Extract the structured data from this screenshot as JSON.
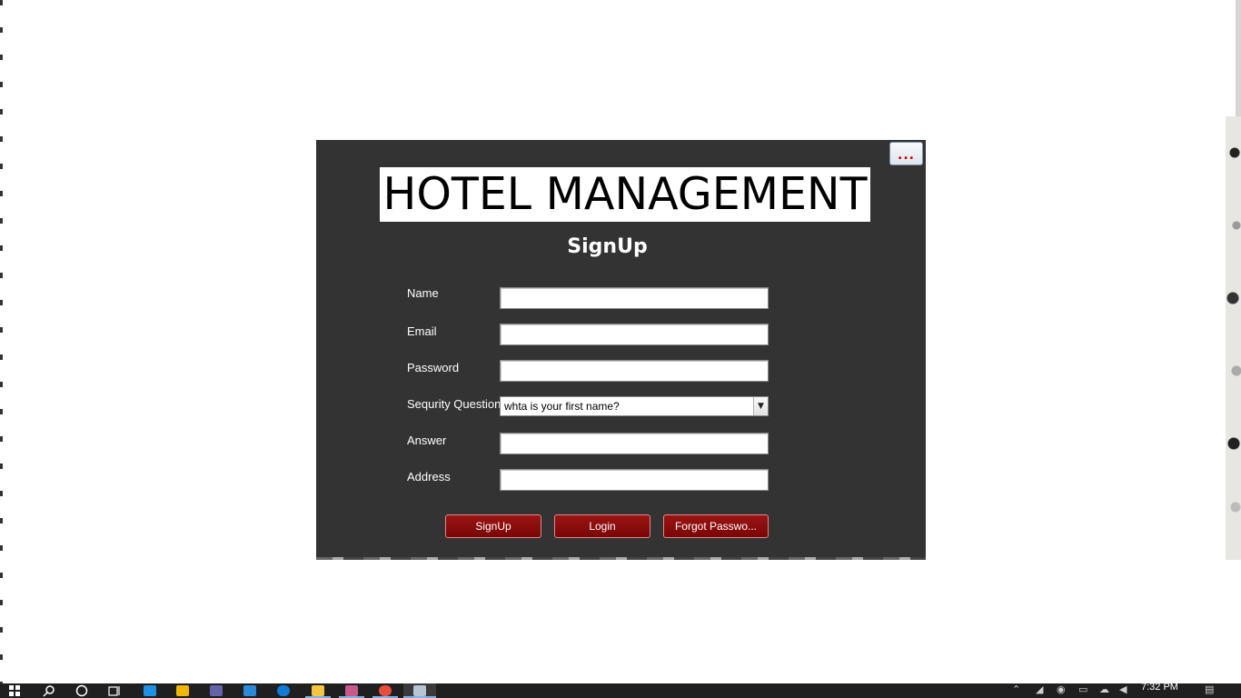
{
  "dialog": {
    "title": "HOTEL MANAGEMENT",
    "heading": "SignUp",
    "more_button_label": "...",
    "fields": {
      "name": {
        "label": "Name",
        "value": ""
      },
      "email": {
        "label": "Email",
        "value": ""
      },
      "password": {
        "label": "Password",
        "value": ""
      },
      "security_question": {
        "label": "Sequrity Question",
        "selected": "whta is your first name?"
      },
      "answer": {
        "label": "Answer",
        "value": ""
      },
      "address": {
        "label": "Address",
        "value": ""
      }
    },
    "buttons": {
      "signup": "SignUp",
      "login": "Login",
      "forgot": "Forgot Passwo..."
    }
  },
  "taskbar": {
    "clock": "7:32 PM",
    "apps": [
      "start-icon",
      "search-icon",
      "cortana-icon",
      "task-view-icon",
      "store-icon",
      "mail-icon",
      "teams-icon",
      "vscode-icon",
      "edge-icon",
      "file-explorer-icon",
      "app-icon",
      "chrome-icon",
      "java-app-icon"
    ],
    "tray": [
      "chevron-up-icon",
      "network-icon",
      "battery-icon",
      "meet-now-icon",
      "onedrive-icon",
      "volume-icon",
      "notification-icon"
    ]
  }
}
